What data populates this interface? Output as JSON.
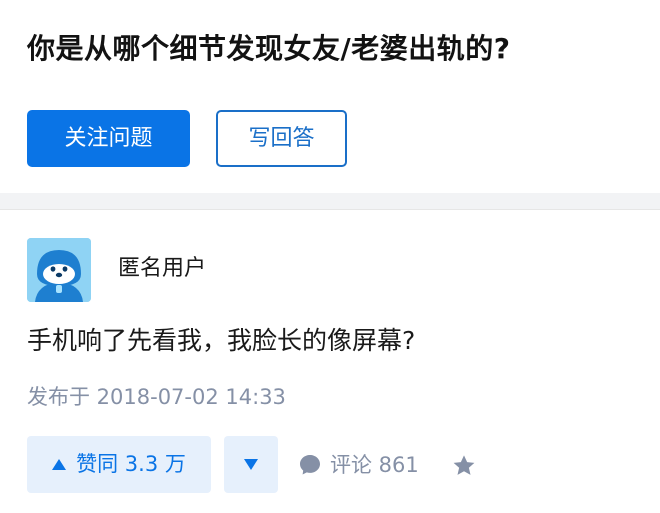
{
  "question": {
    "title": "你是从哪个细节发现女友/老婆出轨的?",
    "follow_label": "关注问题",
    "answer_label": "写回答"
  },
  "answer": {
    "author": "匿名用户",
    "avatar_icon": "anonymous-user-avatar-icon",
    "content": "手机响了先看我，我脸长的像屏幕?",
    "published": "发布于 2018-07-02 14:33"
  },
  "actions": {
    "upvote_label": "赞同 3.3 万",
    "downvote_icon": "triangle-down-icon",
    "comment_label": "评论 861",
    "favorite_icon": "star-icon"
  },
  "colors": {
    "brand_blue": "#0a74e6",
    "muted_gray": "#8590a6",
    "vote_bg": "#e6f0fc"
  }
}
